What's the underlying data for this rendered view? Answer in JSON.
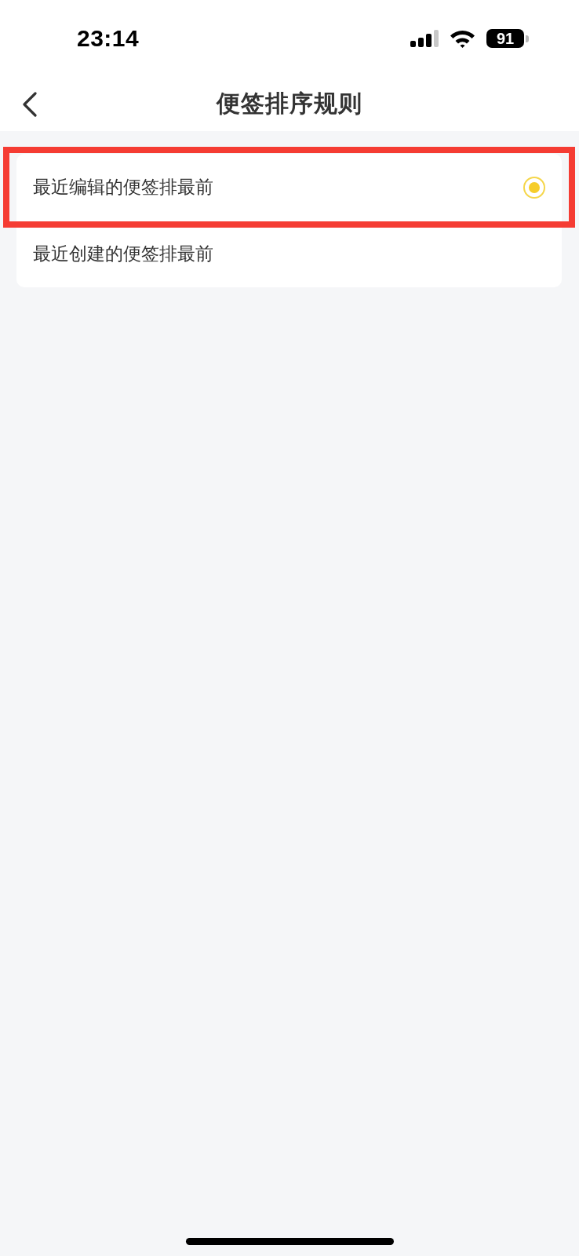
{
  "status_bar": {
    "time": "23:14",
    "battery": "91"
  },
  "nav": {
    "title": "便签排序规则"
  },
  "options": [
    {
      "label": "最近编辑的便签排最前",
      "selected": true,
      "highlighted": true
    },
    {
      "label": "最近创建的便签排最前",
      "selected": false,
      "highlighted": false
    }
  ]
}
